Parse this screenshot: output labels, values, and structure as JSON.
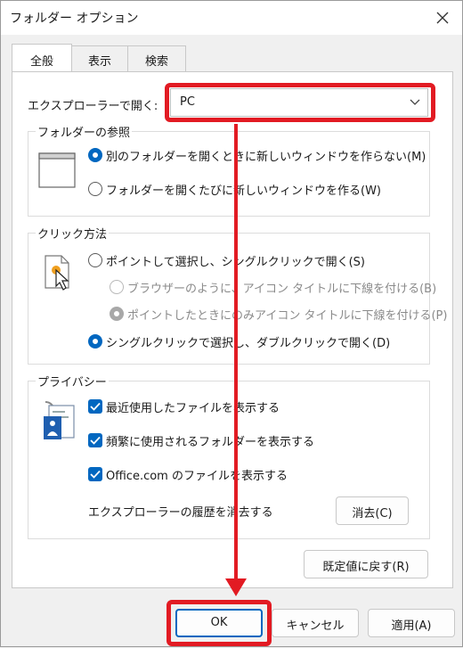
{
  "window": {
    "title": "フォルダー オプション"
  },
  "tabs": [
    {
      "label": "全般"
    },
    {
      "label": "表示"
    },
    {
      "label": "検索"
    }
  ],
  "general": {
    "open_explorer_label": "エクスプローラーで開く:",
    "open_explorer_value": "PC",
    "browse_folders": {
      "title": "フォルダーの参照",
      "opt_same_window": "別のフォルダーを開くときに新しいウィンドウを作らない(M)",
      "opt_new_window": "フォルダーを開くたびに新しいウィンドウを作る(W)"
    },
    "click_items": {
      "title": "クリック方法",
      "opt_single_click": "ポイントして選択し、シングルクリックで開く(S)",
      "opt_underline_browser": "ブラウザーのように、アイコン タイトルに下線を付ける(B)",
      "opt_underline_point": "ポイントしたときにのみアイコン タイトルに下線を付ける(P)",
      "opt_double_click": "シングルクリックで選択し、ダブルクリックで開く(D)"
    },
    "privacy": {
      "title": "プライバシー",
      "chk_recent_files": "最近使用したファイルを表示する",
      "chk_frequent_folders": "頻繁に使用されるフォルダーを表示する",
      "chk_office_files": "Office.com のファイルを表示する",
      "clear_history_label": "エクスプローラーの履歴を消去する",
      "clear_button": "消去(C)"
    },
    "restore_defaults_button": "既定値に戻す(R)"
  },
  "footer": {
    "ok": "OK",
    "cancel": "キャンセル",
    "apply": "適用(A)"
  },
  "colors": {
    "accent": "#0067c0",
    "highlight": "#e21b23"
  }
}
